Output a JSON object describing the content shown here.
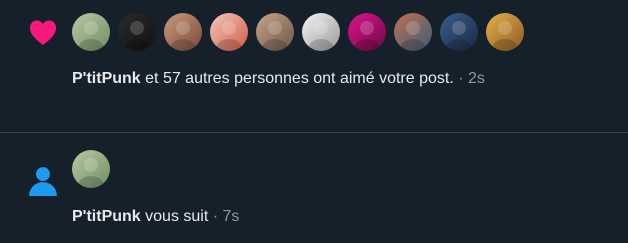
{
  "like_notification": {
    "icon": "heart-icon",
    "icon_color": "#f91880",
    "avatars": [
      {
        "label": "P'titPunk",
        "colors": [
          "#b8c9a4",
          "#6f8f62"
        ]
      },
      {
        "label": "user-2",
        "colors": [
          "#2b2b2b",
          "#111111"
        ]
      },
      {
        "label": "user-3",
        "colors": [
          "#c99a7d",
          "#7a4a38"
        ]
      },
      {
        "label": "user-4",
        "colors": [
          "#f0c9b8",
          "#d25a4a"
        ]
      },
      {
        "label": "user-5",
        "colors": [
          "#c6a58a",
          "#6e5548"
        ]
      },
      {
        "label": "user-6",
        "colors": [
          "#f4f4f4",
          "#9a9a9a"
        ]
      },
      {
        "label": "user-7",
        "colors": [
          "#e0148c",
          "#6b0a48"
        ]
      },
      {
        "label": "user-8",
        "colors": [
          "#c0714f",
          "#3d5a7a"
        ]
      },
      {
        "label": "user-9",
        "colors": [
          "#3a5c8c",
          "#1a2a44"
        ]
      },
      {
        "label": "user-10",
        "colors": [
          "#e7b04a",
          "#8a5a22"
        ]
      }
    ],
    "actor_name": "P'titPunk",
    "message": " et 57 autres personnes ont aimé votre post.",
    "separator": " · ",
    "time": "2s",
    "post_preview": ""
  },
  "follow_notification": {
    "icon": "person-icon",
    "icon_color": "#1d9bf0",
    "avatar": {
      "label": "P'titPunk",
      "colors": [
        "#b8c9a4",
        "#6f8f62"
      ]
    },
    "actor_name": "P'titPunk",
    "message": " vous suit",
    "separator": " · ",
    "time": "7s"
  },
  "divider_color": "#38444d",
  "background_color": "#15202b"
}
